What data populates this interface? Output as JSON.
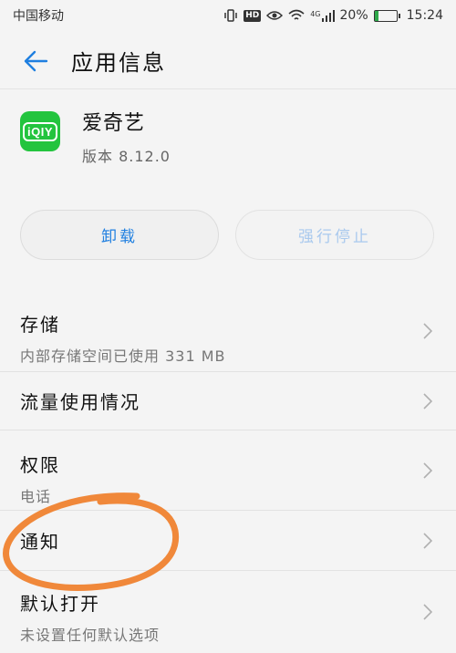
{
  "status_bar": {
    "carrier": "中国移动",
    "hd": "HD",
    "network": "4G",
    "battery": "20%",
    "battery_level": 0.2,
    "time": "15:24"
  },
  "header": {
    "title": "应用信息"
  },
  "app": {
    "name": "爱奇艺",
    "icon_text": "iQIY",
    "version": "版本 8.12.0"
  },
  "actions": {
    "uninstall": "卸载",
    "force_stop": "强行停止"
  },
  "list": [
    {
      "title": "存储",
      "subtitle": "内部存储空间已使用 331 MB"
    },
    {
      "title": "流量使用情况"
    },
    {
      "title": "权限",
      "subtitle": "电话"
    },
    {
      "title": "通知"
    },
    {
      "title": "默认打开",
      "subtitle": "未设置任何默认选项"
    }
  ],
  "colors": {
    "accent": "#1f7fe0",
    "disabled_text": "#a9c9ee",
    "app_icon": "#23c43e",
    "annotation": "#f0883a"
  }
}
